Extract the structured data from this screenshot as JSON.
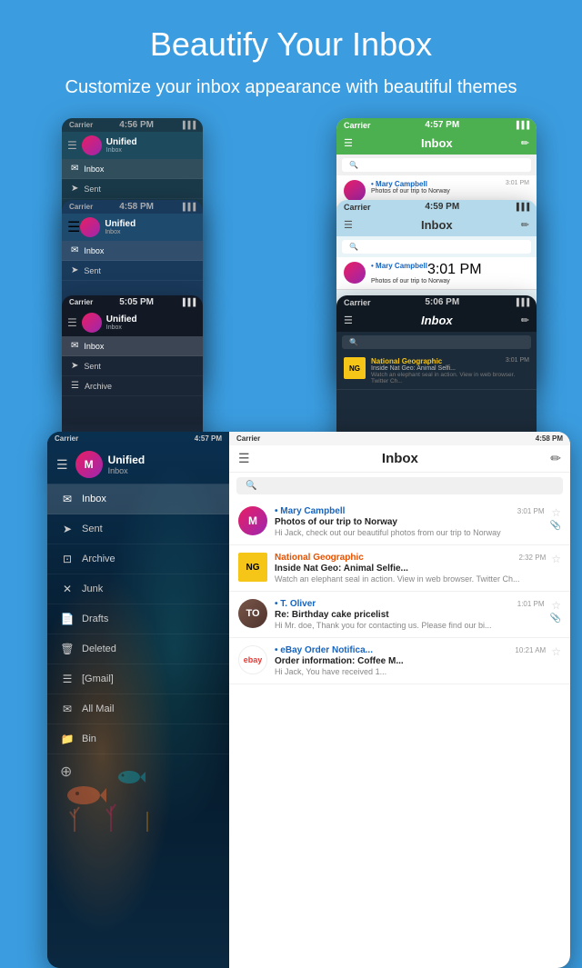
{
  "header": {
    "title": "Beautify Your Inbox",
    "subtitle": "Customize your inbox appearance with beautiful themes"
  },
  "phone1": {
    "status": {
      "carrier": "Carrier",
      "time": "4:56 PM"
    },
    "account": {
      "name": "Unified",
      "sub": "Inbox"
    },
    "menu": [
      {
        "icon": "✉",
        "label": "Inbox",
        "active": true
      },
      {
        "icon": "➤",
        "label": "Sent",
        "active": false
      }
    ]
  },
  "phone2": {
    "status": {
      "carrier": "Carrier",
      "time": "4:57 PM"
    },
    "title": "Inbox",
    "email": {
      "sender": "• Mary Campbell",
      "time": "3:01 PM",
      "subject": "Photos of our trip to Norway"
    }
  },
  "phone3": {
    "status": {
      "carrier": "Carrier",
      "time": "4:58 PM"
    },
    "account": {
      "name": "Unified",
      "sub": "Inbox"
    },
    "menu": [
      {
        "icon": "✉",
        "label": "Inbox",
        "active": true
      },
      {
        "icon": "➤",
        "label": "Sent",
        "active": false
      }
    ]
  },
  "phone4": {
    "status": {
      "carrier": "Carrier",
      "time": "4:59 PM"
    },
    "title": "Inbox",
    "email": {
      "sender": "• Mary Campbell",
      "time": "3:01 PM",
      "subject": "Photos of our trip to Norway"
    }
  },
  "phone5": {
    "status": {
      "carrier": "Carrier",
      "time": "5:05 PM"
    },
    "account": {
      "name": "Unified",
      "sub": "Inbox"
    },
    "menu": [
      {
        "icon": "✉",
        "label": "Inbox",
        "active": true
      },
      {
        "icon": "➤",
        "label": "Sent",
        "active": false
      },
      {
        "icon": "☰",
        "label": "Archive",
        "active": false
      }
    ]
  },
  "phone6": {
    "status": {
      "carrier": "Carrier",
      "time": "5:06 PM"
    },
    "title": "Inbox",
    "email": {
      "sender": "National Geographic",
      "time": "3:01 PM",
      "subject": "Inside Nat Geo: Animal Selfi...",
      "body": "Watch an elephant seal in action. View in web browser. Twitter Ch..."
    }
  },
  "phone7": {
    "left_status": {
      "carrier": "Carrier",
      "time": "4:57 PM"
    },
    "right_status": {
      "carrier": "Carrier",
      "time": "4:58 PM"
    },
    "account": {
      "name": "Unified",
      "sub": "Inbox"
    },
    "title": "Inbox",
    "sidebar_menu": [
      {
        "icon": "✉",
        "label": "Inbox",
        "active": true
      },
      {
        "icon": "➤",
        "label": "Sent",
        "active": false
      },
      {
        "icon": "⊡",
        "label": "Archive",
        "active": false
      },
      {
        "icon": "✕",
        "label": "Junk",
        "active": false
      },
      {
        "icon": "📄",
        "label": "Drafts",
        "active": false
      },
      {
        "icon": "🗑",
        "label": "Deleted",
        "active": false
      },
      {
        "icon": "☰",
        "label": "[Gmail]",
        "active": false
      },
      {
        "icon": "✉",
        "label": "All Mail",
        "active": false
      },
      {
        "icon": "📁",
        "label": "Bin",
        "active": false
      }
    ],
    "emails": [
      {
        "type": "person",
        "sender": "• Mary Campbell",
        "time": "3:01 PM",
        "subject": "Photos of our trip to Norway",
        "body": "Hi Jack, check out our beautiful photos from our trip to Norway",
        "starred": false,
        "has_attach": true,
        "initials": "M"
      },
      {
        "type": "natgeo",
        "sender": "National Geographic",
        "time": "2:32 PM",
        "subject": "Inside Nat Geo: Animal Selfie...",
        "body": "Watch an elephant seal in action. View in web browser. Twitter Ch...",
        "starred": false,
        "has_attach": false,
        "initials": "NG"
      },
      {
        "type": "person",
        "sender": "• T. Oliver",
        "time": "1:01 PM",
        "subject": "Re: Birthday cake pricelist",
        "body": "Hi Mr. doe, Thank you for contacting us. Please find our bi...",
        "starred": false,
        "has_attach": true,
        "initials": "T"
      },
      {
        "type": "ebay",
        "sender": "• eBay Order Notifica...",
        "time": "10:21 AM",
        "subject": "Order information: Coffee M...",
        "body": "Hi Jack, You have received 1...",
        "starred": false,
        "has_attach": false,
        "initials": "e"
      }
    ]
  }
}
